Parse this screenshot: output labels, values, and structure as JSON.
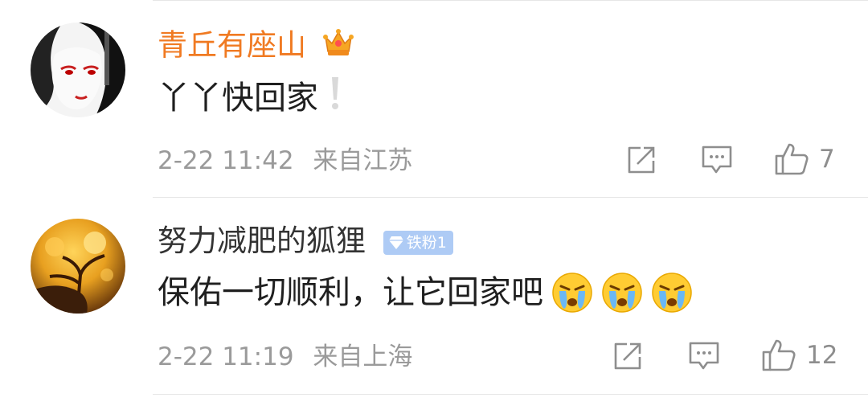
{
  "colors": {
    "vip_name": "#f07a22",
    "normal_name": "#333333",
    "meta": "#9a9a9a",
    "badge_bg": "#aecbf5"
  },
  "comments": [
    {
      "username": "青丘有座山",
      "name_style": "vip",
      "user_badge_icon": "crown-icon",
      "text": "丫丫快回家",
      "trailing_icon": "exclamation-icon",
      "timestamp": "2-22 11:42",
      "location": "来自江苏",
      "like_count": "7"
    },
    {
      "username": "努力减肥的狐狸",
      "name_style": "normal",
      "badge_label": "铁粉1",
      "badge_icon": "diamond-icon",
      "text": "保佑一切顺利，让它回家吧",
      "trailing_icons": [
        "crying-emoji-icon",
        "crying-emoji-icon",
        "crying-emoji-icon"
      ],
      "timestamp": "2-22 11:19",
      "location": "来自上海",
      "like_count": "12"
    }
  ],
  "actions": {
    "repost_icon": "share-icon",
    "reply_icon": "comment-icon",
    "like_icon": "thumbs-up-icon"
  }
}
